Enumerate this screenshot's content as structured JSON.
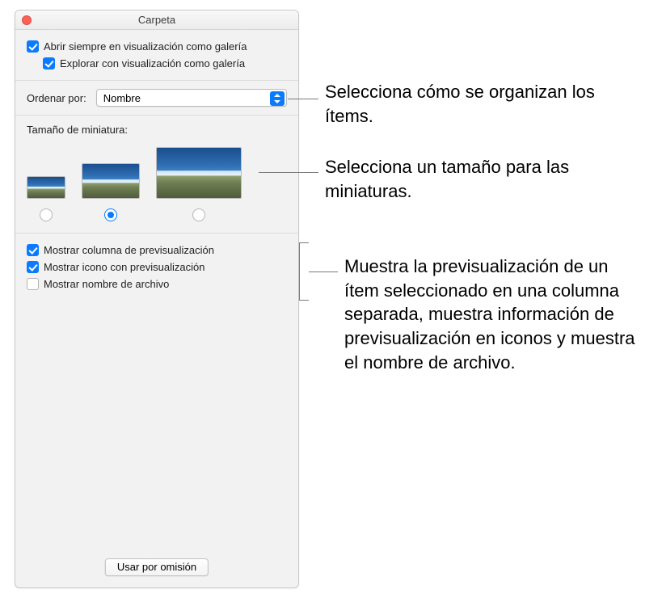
{
  "window": {
    "title": "Carpeta"
  },
  "topChecks": {
    "openAlways": {
      "label": "Abrir siempre en visualización como galería",
      "checked": true
    },
    "browse": {
      "label": "Explorar con visualización como galería",
      "checked": true
    }
  },
  "sort": {
    "label": "Ordenar por:",
    "value": "Nombre"
  },
  "thumbSection": {
    "label": "Tamaño de miniatura:",
    "selected": 1
  },
  "viewChecks": {
    "previewCol": {
      "label": "Mostrar columna de previsualización",
      "checked": true
    },
    "iconPrev": {
      "label": "Mostrar icono con previsualización",
      "checked": true
    },
    "filename": {
      "label": "Mostrar nombre de archivo",
      "checked": false
    }
  },
  "button": {
    "label": "Usar por omisión"
  },
  "callouts": {
    "sort": "Selecciona cómo se organizan los ítems.",
    "thumb": "Selecciona un tamaño para las miniaturas.",
    "checks": "Muestra la previsualización de un ítem seleccionado en una columna separada, muestra información de previsualización en iconos y muestra el nombre de archivo."
  }
}
